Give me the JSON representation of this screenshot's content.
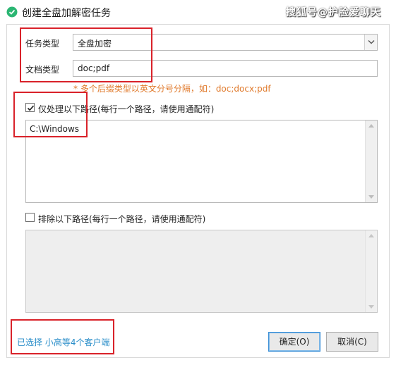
{
  "window": {
    "title": "创建全盘加解密任务",
    "watermark": "搜狐号@护脸爱聊天"
  },
  "form": {
    "task_type_label": "任务类型",
    "task_type_value": "全盘加密",
    "doc_type_label": "文档类型",
    "doc_type_value": "doc;pdf",
    "doc_type_hint": "* 多个后缀类型以英文分号分隔，如：doc;docx;pdf"
  },
  "include_paths": {
    "checked": true,
    "label": "仅处理以下路径(每行一个路径，请使用通配符)",
    "value": "C:\\Windows"
  },
  "exclude_paths": {
    "checked": false,
    "label": "排除以下路径(每行一个路径，请使用通配符)",
    "value": ""
  },
  "footer": {
    "selected_clients": "已选择 小高等4个客户端",
    "ok_label": "确定(O)",
    "cancel_label": "取消(C)"
  },
  "colors": {
    "hint": "#e07a2c",
    "link": "#2a8ec9",
    "annotation": "#d9222a",
    "app_icon": "#2bb673"
  },
  "icons": [
    "app-icon",
    "chevron-down-icon",
    "checkmark-icon",
    "scroll-up-icon",
    "scroll-down-icon"
  ]
}
